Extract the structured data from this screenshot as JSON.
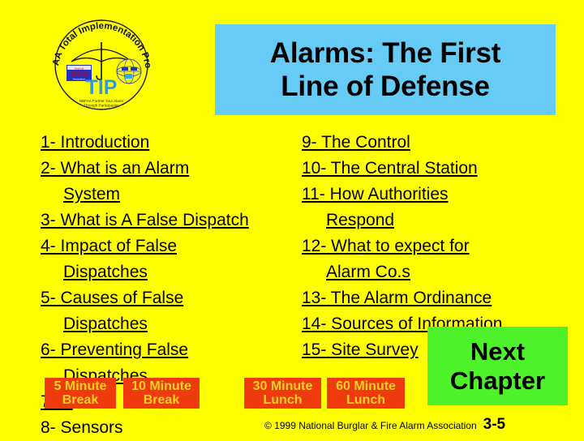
{
  "slide": {
    "background_color": "#FFFF00",
    "title_bg_color": "#66CCF5",
    "button_red_color": "#EE3A0C",
    "button_red_text_color": "#FFD21E",
    "button_green_color": "#4DF22B",
    "text_color": "#000000"
  },
  "logo": {
    "name": "nbfaa-tip-logo",
    "arc_text": "NBFAA Total Implementation Project",
    "monogram": "TIP",
    "caption_line1": "NBFAA Further Your Alarm",
    "caption_line2": "Through Participation"
  },
  "header": {
    "title_line1": "Alarms: The First",
    "title_line2": "Line of Defense"
  },
  "toc": {
    "left_column": [
      {
        "id": "item-1",
        "label": "1- Introduction",
        "sub": null,
        "link": true
      },
      {
        "id": "item-2",
        "label": "2- What is an Alarm",
        "sub": "System",
        "link": true
      },
      {
        "id": "item-3",
        "label": "3- What is A False Dispatch",
        "sub": null,
        "link": true
      },
      {
        "id": "item-4",
        "label": "4- Impact of False",
        "sub": "Dispatches",
        "link": true
      },
      {
        "id": "item-5",
        "label": "5- Causes of False",
        "sub": "Dispatches",
        "link": true
      },
      {
        "id": "item-6",
        "label": "6- Preventing False",
        "sub": "Dispatches",
        "link": true
      },
      {
        "id": "item-7",
        "label": "7- C",
        "sub": null,
        "link": true
      },
      {
        "id": "item-8",
        "label": "8- Sensors",
        "sub": null,
        "link": false
      }
    ],
    "right_column": [
      {
        "id": "item-9",
        "label": "9- The Control",
        "sub": null,
        "link": true
      },
      {
        "id": "item-10",
        "label": "10- The Central Station",
        "sub": null,
        "link": true
      },
      {
        "id": "item-11",
        "label": "11- How Authorities",
        "sub": "Respond",
        "link": true
      },
      {
        "id": "item-12",
        "label": "12- What to expect for",
        "sub": "Alarm Co.s",
        "link": true
      },
      {
        "id": "item-13",
        "label": "13- The Alarm Ordinance",
        "sub": null,
        "link": true
      },
      {
        "id": "item-14",
        "label": "14- Sources of Information",
        "sub": null,
        "link": true
      },
      {
        "id": "item-15",
        "label": "15- Site Survey",
        "sub": null,
        "link": true
      }
    ]
  },
  "buttons": {
    "break_5": {
      "line1": "5 Minute",
      "line2": "Break"
    },
    "break_10": {
      "line1": "10 Minute",
      "line2": "Break"
    },
    "lunch_30": {
      "line1": "30 Minute",
      "line2": "Lunch"
    },
    "lunch_60": {
      "line1": "60 Minute",
      "line2": "Lunch"
    },
    "next_chapter": {
      "line1": "Next",
      "line2": "Chapter"
    }
  },
  "footer": {
    "copyright": "© 1999 National Burglar & Fire Alarm Association",
    "page_number": "3-5"
  }
}
